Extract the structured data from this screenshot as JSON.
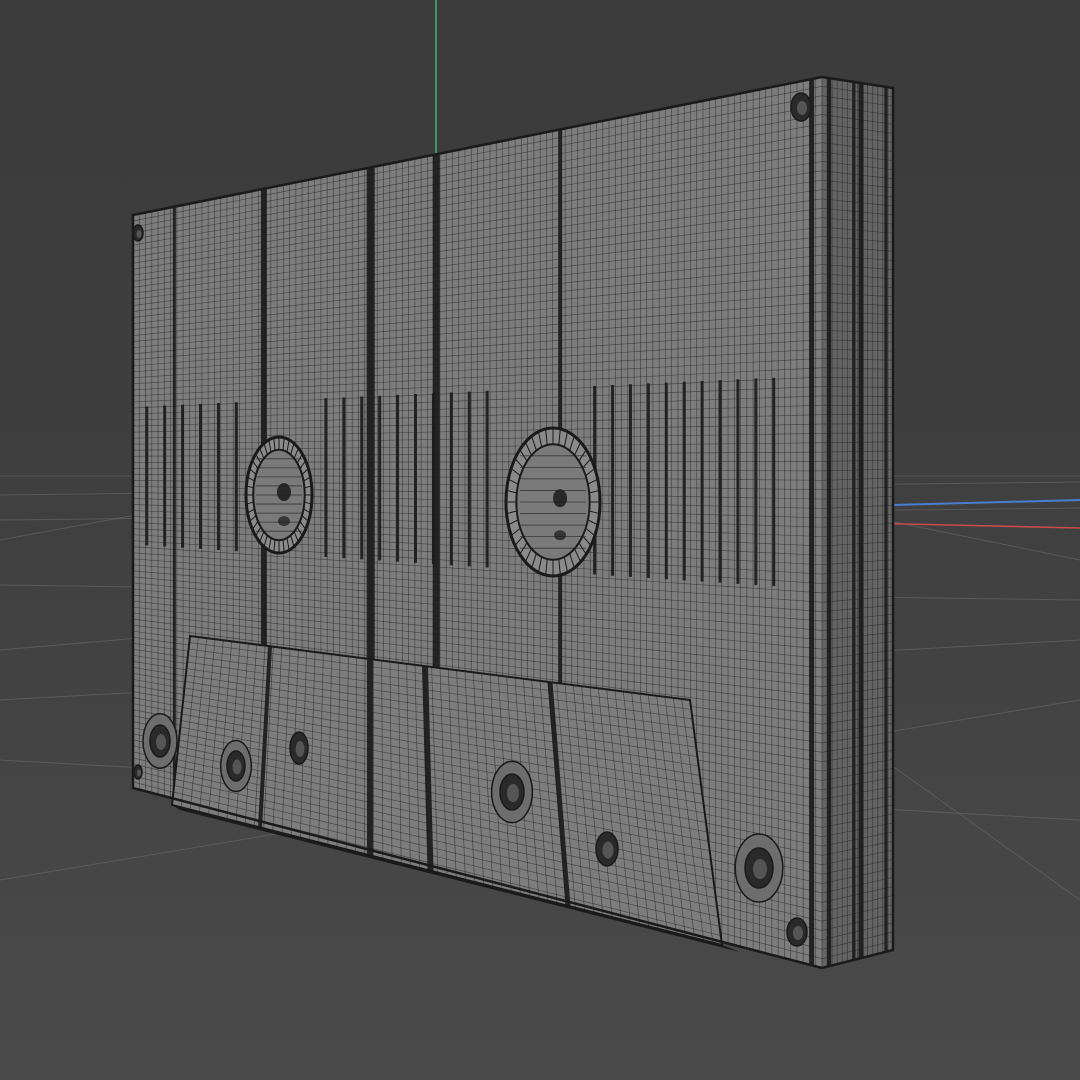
{
  "viewport": {
    "background_color": "#3f3f3f",
    "grid_color": "#6a6a6a",
    "axis_colors": {
      "x": "#c84a4a",
      "y": "#3fae74",
      "z": "#4a7ccf"
    }
  },
  "model": {
    "object": "cassette-tape-mesh",
    "display_mode": "wireframe",
    "face_color": "#7d7d7d",
    "side_color": "#646464",
    "wire_color": "#1a1a1a"
  }
}
